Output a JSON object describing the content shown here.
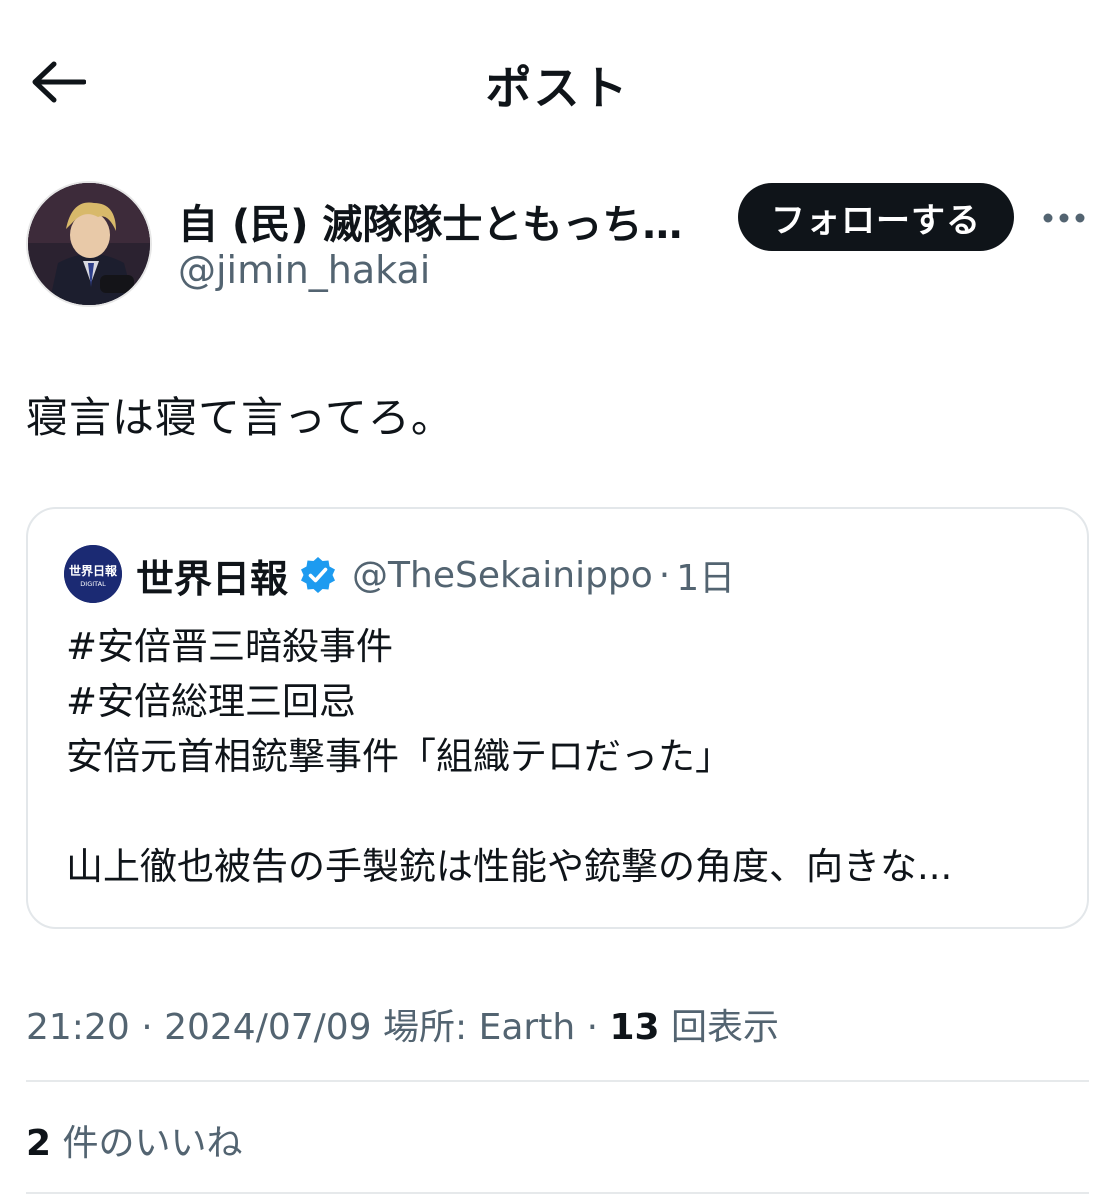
{
  "header": {
    "title": "ポスト"
  },
  "author": {
    "display_name": "自 (民) 滅隊隊士ともっちマ...",
    "handle": "@jimin_hakai",
    "follow_label": "フォローする"
  },
  "post": {
    "text": "寝言は寝て言ってろ。"
  },
  "quote": {
    "avatar_text": "世界日報",
    "avatar_subtext": "DIGITAL",
    "name": "世界日報",
    "handle": "@TheSekainippo",
    "dot": "·",
    "time": "1日",
    "lines": [
      "#安倍晋三暗殺事件",
      "#安倍総理三回忌",
      "安倍元首相銃撃事件「組織テロだった」",
      "",
      "山上徹也被告の手製銃は性能や銃撃の角度、向きな..."
    ]
  },
  "meta": {
    "time": "21:20",
    "sep1": " · ",
    "date": "2024/07/09",
    "location": " 場所: Earth",
    "sep2": " · ",
    "views_count": "13",
    "views_label": " 回表示"
  },
  "likes": {
    "count": "2",
    "label": " 件のいいね"
  },
  "colors": {
    "text": "#0f1419",
    "secondary": "#536471",
    "verified": "#1d9bf0",
    "border": "#e3e7ea"
  }
}
